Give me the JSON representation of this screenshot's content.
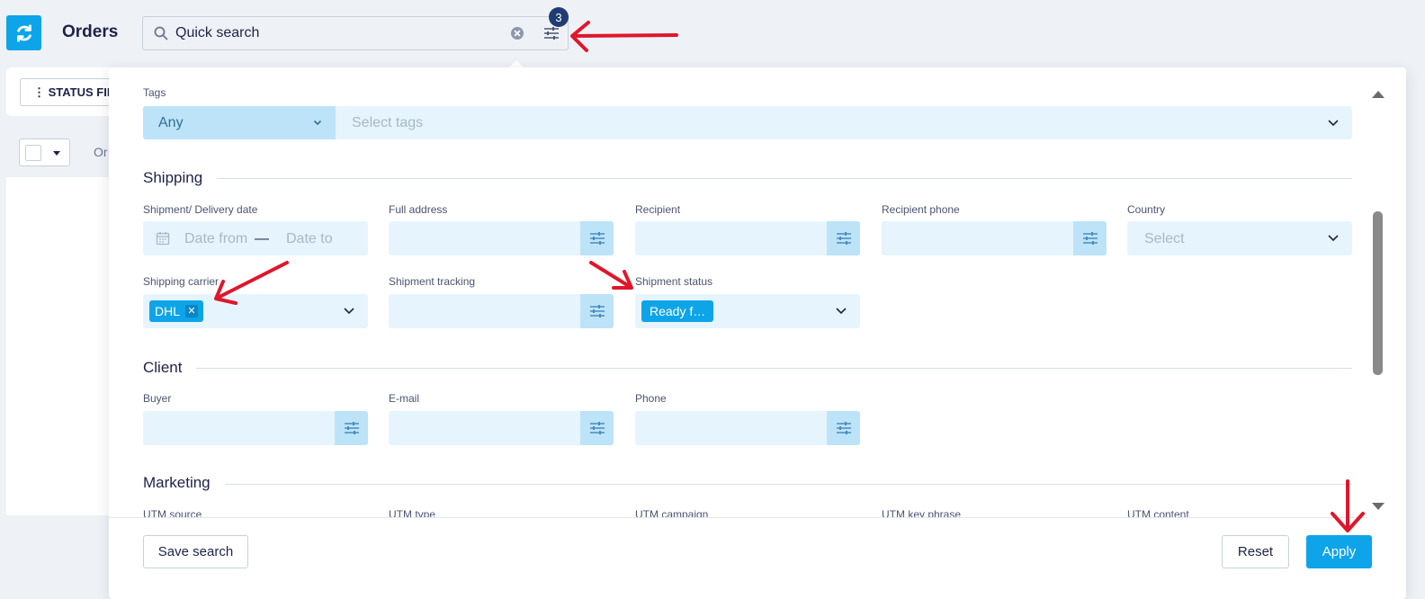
{
  "header": {
    "title": "Orders",
    "search_placeholder": "Quick search",
    "filter_count": "3"
  },
  "background": {
    "status_filter_label": "⋮ STATUS FIL",
    "orders_label": "Or"
  },
  "filters": {
    "tags": {
      "label": "Tags",
      "mode": "Any",
      "placeholder": "Select tags"
    },
    "shipping": {
      "title": "Shipping",
      "delivery_date": {
        "label": "Shipment/ Delivery date",
        "from": "Date from",
        "separator": "—",
        "to": "Date to"
      },
      "full_address": {
        "label": "Full address"
      },
      "recipient": {
        "label": "Recipient"
      },
      "recipient_phone": {
        "label": "Recipient phone"
      },
      "country": {
        "label": "Country",
        "placeholder": "Select"
      },
      "carrier": {
        "label": "Shipping carrier",
        "chip": "DHL"
      },
      "tracking": {
        "label": "Shipment tracking"
      },
      "status": {
        "label": "Shipment status",
        "chip": "Ready f…"
      }
    },
    "client": {
      "title": "Client",
      "buyer": {
        "label": "Buyer"
      },
      "email": {
        "label": "E-mail"
      },
      "phone": {
        "label": "Phone"
      }
    },
    "marketing": {
      "title": "Marketing",
      "utm_source": "UTM source",
      "utm_type": "UTM type",
      "utm_campaign": "UTM campaign",
      "utm_key_phrase": "UTM key phrase",
      "utm_content": "UTM content"
    }
  },
  "footer": {
    "save_search": "Save search",
    "reset": "Reset",
    "apply": "Apply"
  },
  "colors": {
    "accent": "#0ea4e9",
    "field_bg": "#e6f5fd",
    "badge": "#1f3c73",
    "annotation_arrow": "#e0162b"
  },
  "icons": [
    "refresh-icon",
    "search-icon",
    "clear-icon",
    "sliders-icon",
    "calendar-icon",
    "chevron-down-icon"
  ]
}
